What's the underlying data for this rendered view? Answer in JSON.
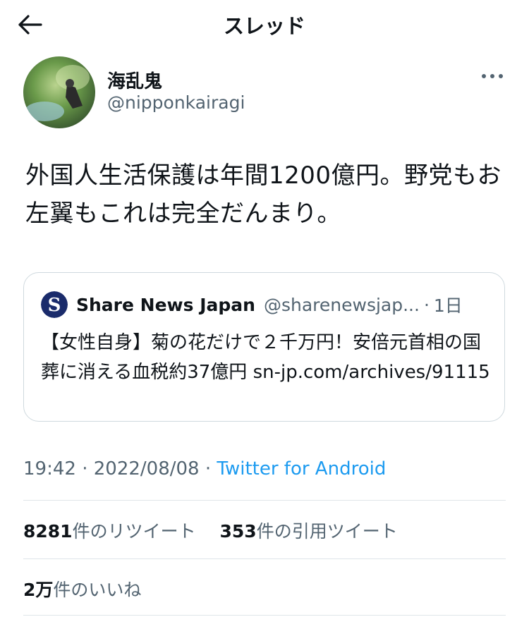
{
  "header": {
    "title": "スレッド",
    "back_icon": "arrow-left-icon"
  },
  "tweet": {
    "author": {
      "display_name": "海乱鬼",
      "handle": "@nipponkairagi"
    },
    "more_icon": "more-horizontal-icon",
    "text": "外国人生活保護は年間1200億円。野党もお左翼もこれは完全だんまり。",
    "quoted": {
      "logo_letter": "S",
      "name": "Share News Japan",
      "handle": "@sharenewsjap...",
      "separator": "·",
      "time": "1日",
      "text": "【女性自身】菊の花だけで２千万円！安倍元首相の国葬に消える血税約37億円 sn-jp.com/archives/91115"
    },
    "meta": {
      "time": "19:42",
      "sep1": "·",
      "date": "2022/08/08",
      "sep2": "·",
      "source": "Twitter for Android"
    },
    "stats": {
      "retweets": {
        "value": "8281",
        "label": "件のリツイート"
      },
      "quotes": {
        "value": "353",
        "label": "件の引用ツイート"
      },
      "likes": {
        "value": "2万",
        "label": "件のいいね"
      }
    }
  },
  "colors": {
    "text": "#0f1419",
    "secondary": "#536471",
    "link": "#1d9bf0",
    "border": "#cfd9de",
    "quoted_logo_bg": "#1a2b6b"
  }
}
